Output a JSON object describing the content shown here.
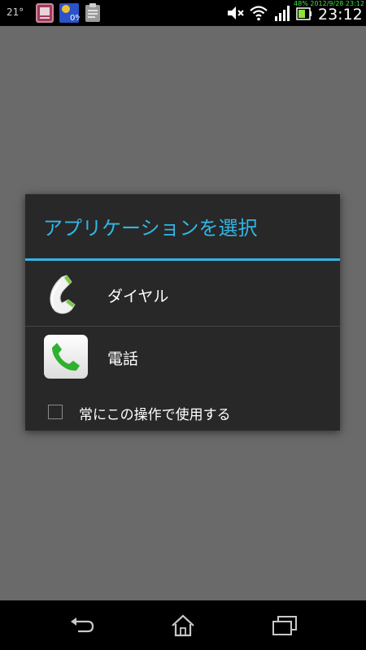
{
  "status_bar": {
    "temperature": "21°",
    "percent_badge": "0%",
    "stamp": "48% 2012/9/28 23:12",
    "clock": "23:12"
  },
  "icons": {
    "notif_1": "diary-app-icon",
    "notif_2": "battery-percent-app-icon",
    "notif_3": "clipboard-icon",
    "mute": "volume-muted-icon",
    "wifi": "wifi-icon",
    "signal": "cell-signal-icon",
    "battery": "battery-charging-icon",
    "dialer": "handset-icon",
    "phone": "phone-app-icon",
    "back": "back-icon",
    "home": "home-icon",
    "recent": "recent-apps-icon"
  },
  "dialog": {
    "title": "アプリケーションを選択",
    "apps": [
      {
        "label": "ダイヤル"
      },
      {
        "label": "電話"
      }
    ],
    "always_label": "常にこの操作で使用する",
    "always_checked": false
  },
  "colors": {
    "accent": "#33b5e5",
    "dialog_bg": "#282828",
    "scrim_bg": "#6a6a6a",
    "bar_bg": "#000000",
    "phone_green": "#2fb12f"
  }
}
